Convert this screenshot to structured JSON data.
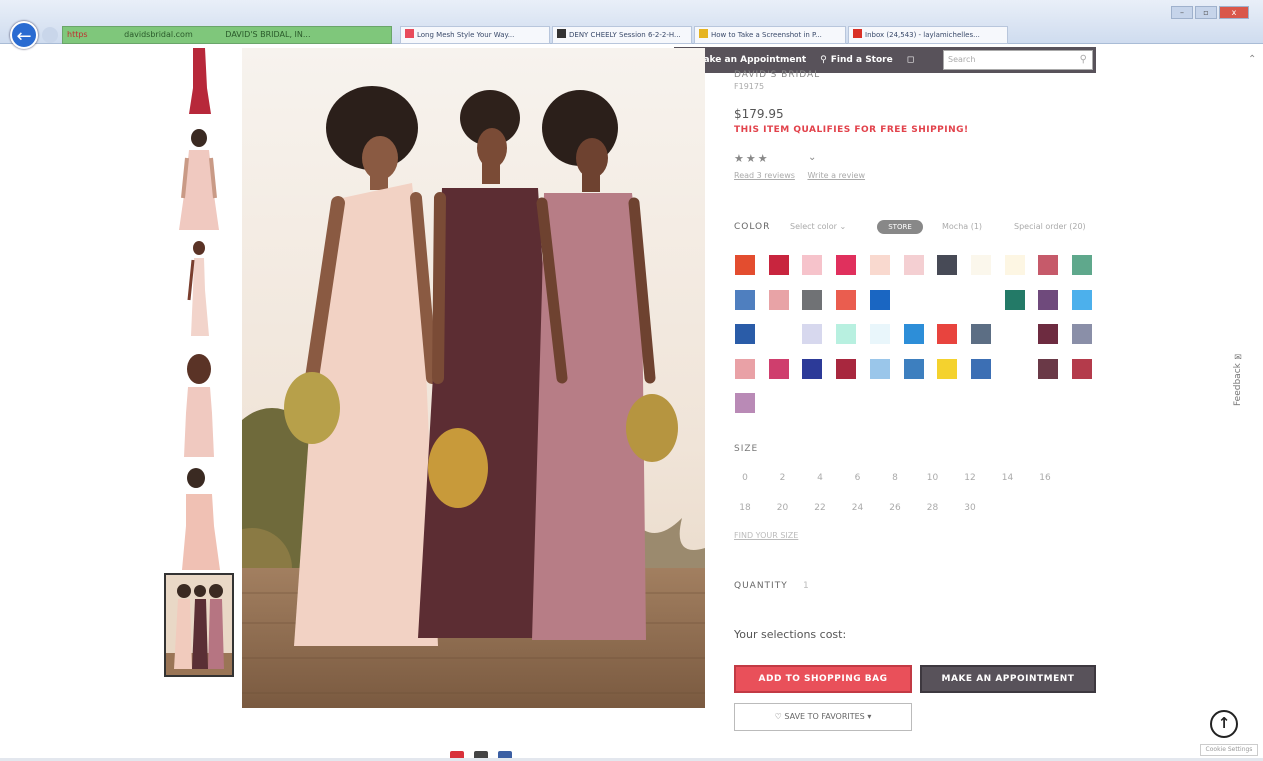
{
  "browser": {
    "address_lock": "https",
    "address_url": "davidsbridal.com",
    "address_site": "DAVID'S BRIDAL, IN...",
    "tabs": [
      {
        "label": "Long Mesh Style Your Way...",
        "icon_color": "#e84b5b"
      },
      {
        "label": "DENY CHEELY Session 6-2-2-H...",
        "icon_color": "#333333"
      },
      {
        "label": "How to Take a Screenshot in P...",
        "icon_color": "#e6b422"
      },
      {
        "label": "Inbox (24,543) - laylamichelles...",
        "icon_color": "#d93025"
      }
    ],
    "window_controls": [
      "–",
      "▫",
      "x"
    ]
  },
  "site_nav": {
    "appointment": "Make an Appointment",
    "find_store": "Find a Store",
    "search_placeholder": "Search"
  },
  "product": {
    "brand": "DAVID'S BRIDAL",
    "style_number": "F19175",
    "price": "$179.95",
    "free_shipping": "THIS ITEM QUALIFIES FOR FREE SHIPPING!",
    "stars": "★★★",
    "read_reviews": "Read 3 reviews",
    "write_review": "Write a review"
  },
  "color": {
    "label": "COLOR",
    "select": "Select color",
    "pill": "STORE",
    "option_2": "Mocha (1)",
    "option_3": "Special order (20)",
    "swatches": [
      "#e34d2f",
      "#c8253e",
      "#f6c3cb",
      "#e0305d",
      "#f9d9cf",
      "#f4cfd2",
      "#474a56",
      "#fbf7ec",
      "#fdf6e3",
      "#c65a6a",
      "#5fa88c",
      "#4f7fbf",
      "#e8a3a6",
      "#707275",
      "#ea5d4f",
      "#1a66c2",
      "",
      "",
      "",
      "#237a67",
      "#6f4a7c",
      "#4cb0ec",
      "#2a5ca8",
      "",
      "#d7d8ee",
      "#b8f0e0",
      "#e9f6fb",
      "#2d8ed8",
      "#e8443e",
      "#5c6e84",
      "",
      "#6d2b40",
      "#8a8fa8",
      "#e9a1a6",
      "#cf3e6d",
      "#2c3a98",
      "#a8273e",
      "#9ac6ea",
      "#3d7fbf",
      "#f4d22e",
      "#3c6fb4",
      "",
      "#6a3947",
      "#b43b4b",
      "#b98ab6"
    ]
  },
  "size": {
    "label": "SIZE",
    "values": [
      "0",
      "2",
      "4",
      "6",
      "8",
      "10",
      "12",
      "14",
      "16",
      "18",
      "20",
      "22",
      "24",
      "26",
      "28",
      "30"
    ],
    "guide": "FIND YOUR SIZE"
  },
  "quantity": {
    "label": "QUANTITY",
    "value": "1"
  },
  "cost_label": "Your selections cost:",
  "buttons": {
    "add_to_bag": "ADD TO SHOPPING BAG",
    "make_appointment": "MAKE AN APPOINTMENT",
    "save_favorites": "SAVE TO FAVORITES"
  },
  "feedback": "Feedback",
  "cookie": "Cookie Settings",
  "colors": {
    "accent": "#e9505a",
    "dark": "#58525a"
  }
}
